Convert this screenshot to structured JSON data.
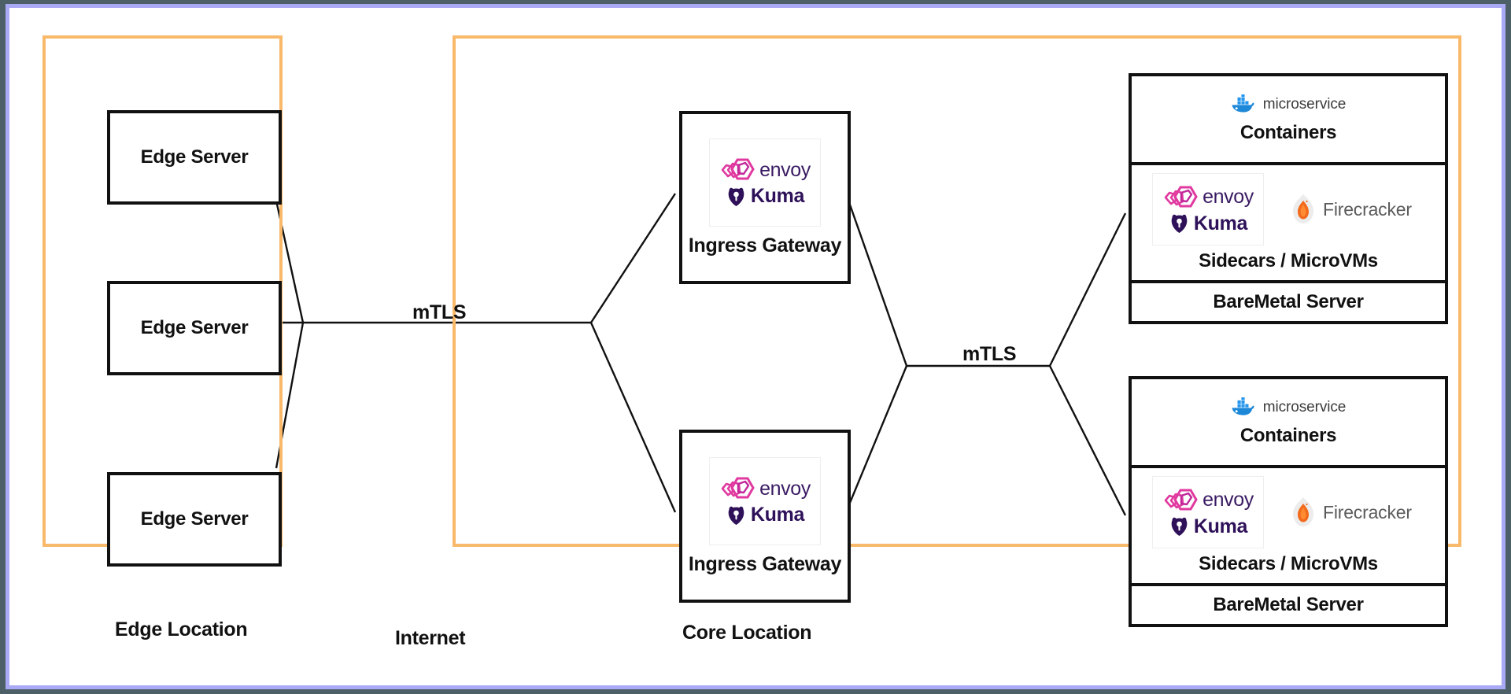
{
  "colors": {
    "page_background": "#4d6068",
    "frame_border": "#a9a9f5",
    "canvas": "#ffffff",
    "zone_border": "#f8b96a",
    "node_border": "#111111",
    "envoy_pink": "#e0399f",
    "envoy_magenta": "#c0289a",
    "envoy_text": "#3a1b63",
    "kuma_purple": "#2e1159",
    "docker_blue": "#2496ed",
    "firecracker_orange": "#f26a1b",
    "firecracker_gray": "#5b5b5b"
  },
  "zones": {
    "edge": {
      "caption": "Edge Location"
    },
    "internet": {
      "caption": "Internet"
    },
    "core": {
      "caption": "Core Location"
    }
  },
  "edge_servers": [
    {
      "label": "Edge Server"
    },
    {
      "label": "Edge Server"
    },
    {
      "label": "Edge Server"
    }
  ],
  "gateways": [
    {
      "label": "Ingress Gateway",
      "logos": {
        "envoy": "envoy",
        "kuma": "Kuma"
      }
    },
    {
      "label": "Ingress Gateway",
      "logos": {
        "envoy": "envoy",
        "kuma": "Kuma"
      }
    }
  ],
  "stacks": [
    {
      "containers": {
        "badge": "microservice",
        "title": "Containers"
      },
      "sidecars": {
        "title": "Sidecars / MicroVMs",
        "envoy": "envoy",
        "kuma": "Kuma",
        "firecracker": "Firecracker"
      },
      "baremetal": {
        "title": "BareMetal Server"
      }
    },
    {
      "containers": {
        "badge": "microservice",
        "title": "Containers"
      },
      "sidecars": {
        "title": "Sidecars / MicroVMs",
        "envoy": "envoy",
        "kuma": "Kuma",
        "firecracker": "Firecracker"
      },
      "baremetal": {
        "title": "BareMetal Server"
      }
    }
  ],
  "connections": {
    "mtls_internet_label": "mTLS",
    "mtls_core_label": "mTLS"
  },
  "icons": {
    "envoy": "envoy-hex-cube-icon",
    "kuma": "kuma-bear-icon",
    "docker": "docker-whale-icon",
    "firecracker": "firecracker-flame-icon"
  }
}
